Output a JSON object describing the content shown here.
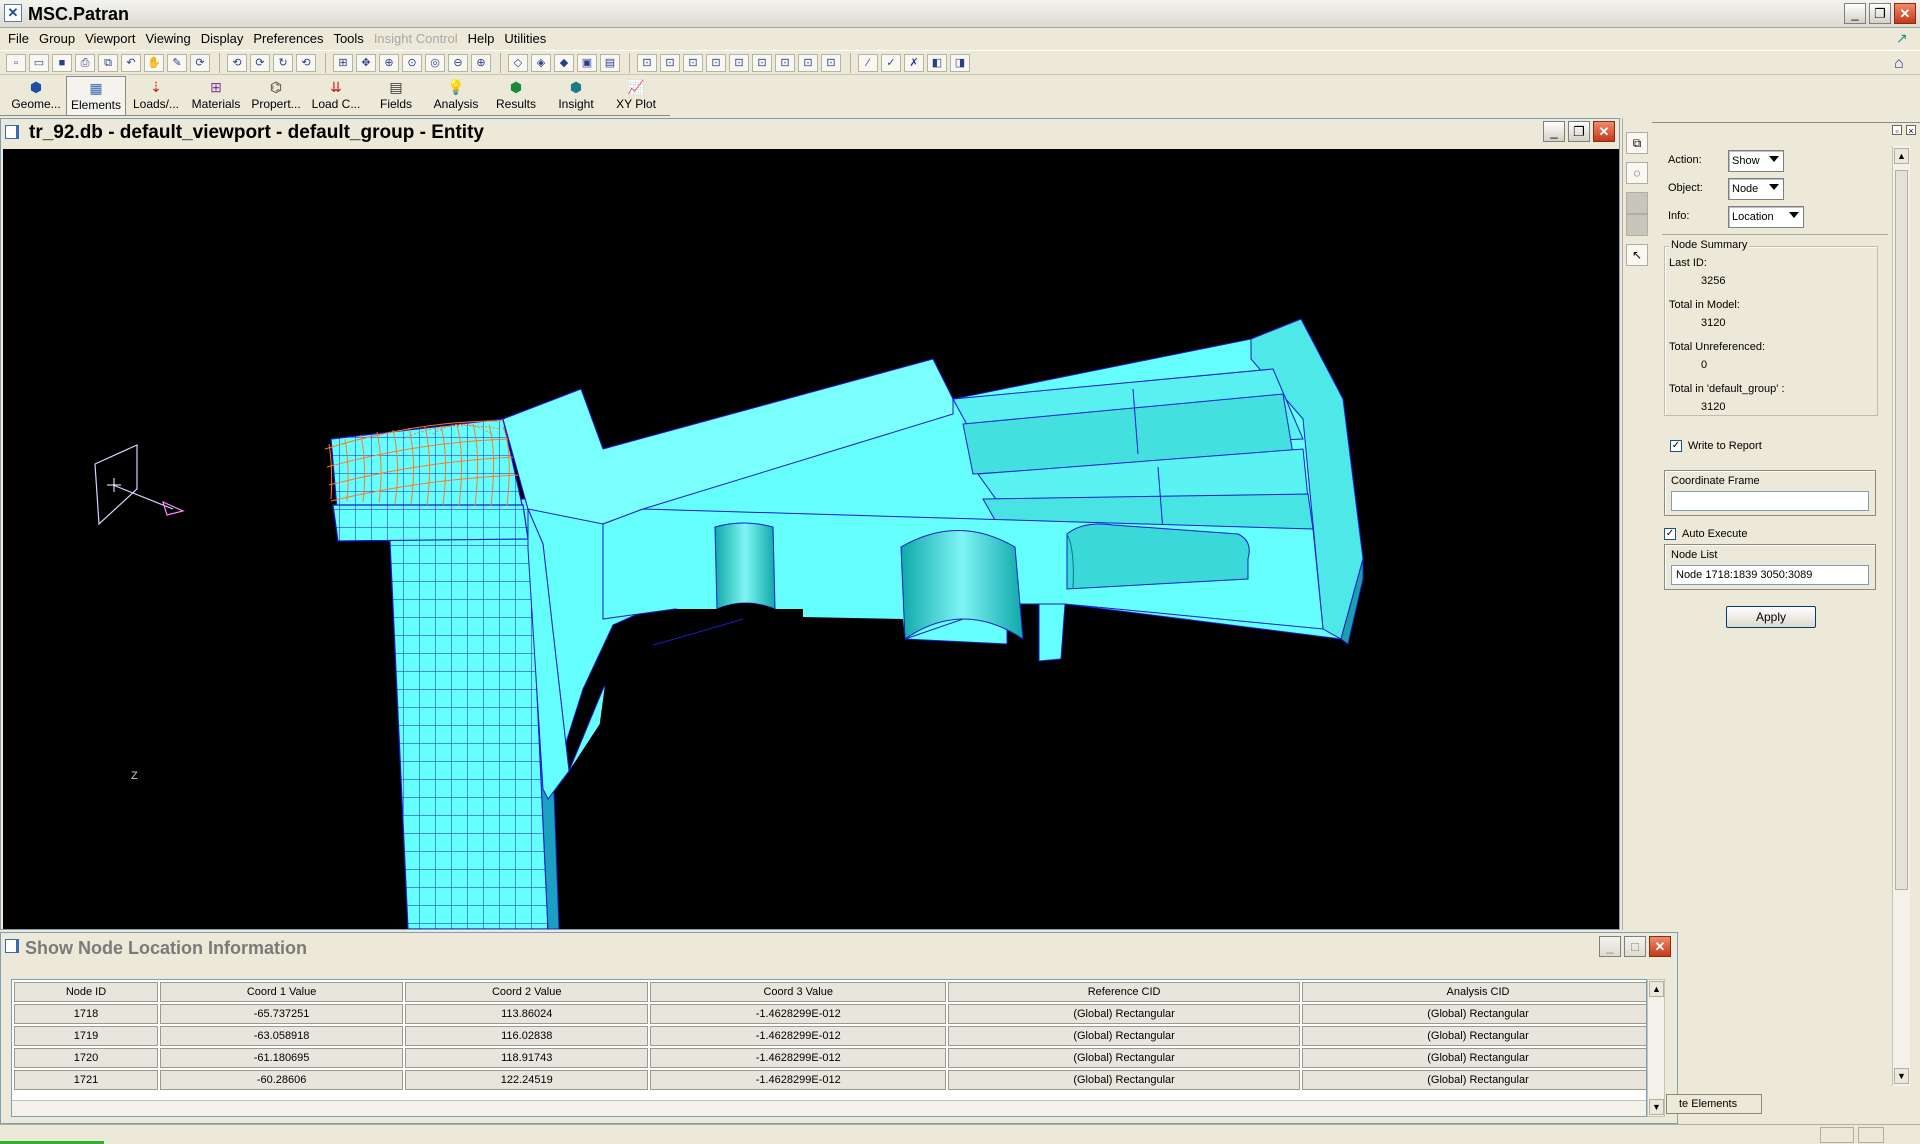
{
  "app": {
    "title": "MSC.Patran"
  },
  "menu": [
    {
      "label": "File",
      "enabled": true
    },
    {
      "label": "Group",
      "enabled": true
    },
    {
      "label": "Viewport",
      "enabled": true
    },
    {
      "label": "Viewing",
      "enabled": true
    },
    {
      "label": "Display",
      "enabled": true
    },
    {
      "label": "Preferences",
      "enabled": true
    },
    {
      "label": "Tools",
      "enabled": true
    },
    {
      "label": "Insight Control",
      "enabled": false
    },
    {
      "label": "Help",
      "enabled": true
    },
    {
      "label": "Utilities",
      "enabled": true
    }
  ],
  "app_tabs": [
    {
      "label": "Geome...",
      "icon": "geometry-icon"
    },
    {
      "label": "Elements",
      "icon": "elements-icon",
      "active": true
    },
    {
      "label": "Loads/...",
      "icon": "loads-icon"
    },
    {
      "label": "Materials",
      "icon": "materials-icon"
    },
    {
      "label": "Propert...",
      "icon": "properties-icon"
    },
    {
      "label": "Load C...",
      "icon": "load-cases-icon"
    },
    {
      "label": "Fields",
      "icon": "fields-icon"
    },
    {
      "label": "Analysis",
      "icon": "analysis-icon"
    },
    {
      "label": "Results",
      "icon": "results-icon"
    },
    {
      "label": "Insight",
      "icon": "insight-icon"
    },
    {
      "label": "XY Plot",
      "icon": "xy-plot-icon"
    }
  ],
  "viewport": {
    "title": "tr_92.db - default_viewport - default_group - Entity",
    "axis_label": "Z",
    "background": "#000000",
    "model_color": "#66ffff",
    "mesh_color": "#1a1acc",
    "highlight_color": "#ff6600"
  },
  "panel": {
    "action_label": "Action:",
    "action_value": "Show",
    "object_label": "Object:",
    "object_value": "Node",
    "info_label": "Info:",
    "info_value": "Location",
    "summary_title": "Node Summary",
    "last_id_label": "Last ID:",
    "last_id_value": "3256",
    "total_model_label": "Total in Model:",
    "total_model_value": "3120",
    "total_unref_label": "Total Unreferenced:",
    "total_unref_value": "0",
    "total_group_label": "Total in 'default_group' :",
    "total_group_value": "3120",
    "write_report_label": "Write to Report",
    "write_report_checked": true,
    "coord_frame_label": "Coordinate Frame",
    "coord_frame_value": "",
    "auto_execute_label": "Auto Execute",
    "auto_execute_checked": true,
    "node_list_label": "Node List",
    "node_list_value": "Node 1718:1839 3050:3089",
    "apply_label": "Apply"
  },
  "info_window": {
    "title": "Show Node Location Information",
    "columns": [
      "Node ID",
      "Coord 1 Value",
      "Coord 2 Value",
      "Coord 3 Value",
      "Reference CID",
      "Analysis CID"
    ],
    "rows": [
      [
        "1718",
        "-65.737251",
        "113.86024",
        "-1.4628299E-012",
        "(Global) Rectangular",
        "(Global) Rectangular"
      ],
      [
        "1719",
        "-63.058918",
        "116.02838",
        "-1.4628299E-012",
        "(Global) Rectangular",
        "(Global) Rectangular"
      ],
      [
        "1720",
        "-61.180695",
        "118.91743",
        "-1.4628299E-012",
        "(Global) Rectangular",
        "(Global) Rectangular"
      ],
      [
        "1721",
        "-60.28606",
        "122.24519",
        "-1.4628299E-012",
        "(Global) Rectangular",
        "(Global) Rectangular"
      ]
    ]
  },
  "bottom_tab": {
    "label": "te Elements"
  }
}
